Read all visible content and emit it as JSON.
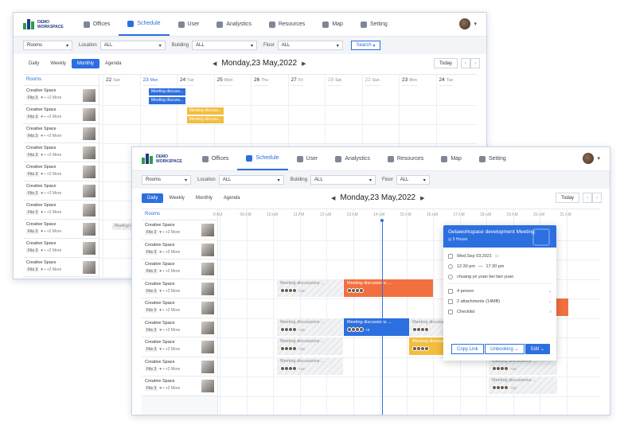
{
  "app": {
    "logo_line1": "DEMO",
    "logo_line2": "WORKSPACE"
  },
  "nav": [
    "Offices",
    "Schedule",
    "User",
    "Analystics",
    "Resources",
    "Map",
    "Setting"
  ],
  "nav_icons": [
    "building-icon",
    "calendar-icon",
    "user-icon",
    "chart-icon",
    "resources-icon",
    "map-icon",
    "gear-icon"
  ],
  "active_nav": "Schedule",
  "filters": {
    "rooms": "Rooms",
    "location_label": "Location",
    "location_value": "ALL",
    "building_label": "Building",
    "building_value": "ALL",
    "floor_label": "Floor",
    "floor_value": "ALL",
    "search": "Search"
  },
  "views": [
    "Daily",
    "Weekly",
    "Monthly",
    "Agenda"
  ],
  "date_title": "Monday,23 May,2022",
  "today": "Today",
  "rooms_header": "Rooms",
  "room": {
    "name": "Creative Space",
    "fits": "Fits 3",
    "more": "+2 More"
  },
  "back": {
    "days": [
      {
        "n": "22",
        "d": "Sun"
      },
      {
        "n": "23",
        "d": "Mon"
      },
      {
        "n": "24",
        "d": "Tue"
      },
      {
        "n": "25",
        "d": "Wed"
      },
      {
        "n": "26",
        "d": "Thu"
      },
      {
        "n": "27",
        "d": "Fri"
      },
      {
        "n": "28",
        "d": "Sat"
      },
      {
        "n": "22",
        "d": "Sun"
      },
      {
        "n": "23",
        "d": "Mon"
      },
      {
        "n": "24",
        "d": "Tue"
      }
    ],
    "events": [
      "Meeting discuss...",
      "Meeting discuss...",
      "Meeting discuss...",
      "Meeting discuss...",
      "Meeting discuss..."
    ]
  },
  "front": {
    "times": [
      "8 AM",
      "09 AM",
      "10 AM",
      "11 AM",
      "12 AM",
      "13 AM",
      "14 AM",
      "15 AM",
      "16 AM",
      "17 AM",
      "18 AM",
      "19 AM",
      "20 AM",
      "21 AM"
    ],
    "event_title": "Meeting discussions ...",
    "extra": "+10",
    "extra2": "+9"
  },
  "popup": {
    "title": "Gelaworkspace development Meeting",
    "subtitle": "5 House",
    "date": "Wed,Sep 03,2021",
    "time_from": "12:30 pm",
    "time_to": "17:30 pm",
    "location": "chuang ye yuan bei lian yuan",
    "people": "4 person",
    "attachments": "2 attachments (14MB)",
    "checklist": "Checklist",
    "copy_link": "Copy Link",
    "unbooking": "Unbooking",
    "edit": "Edit"
  },
  "colors": {
    "accent": "#2c6fe0",
    "orange": "#f2703f",
    "yellow": "#f3bd3e"
  }
}
